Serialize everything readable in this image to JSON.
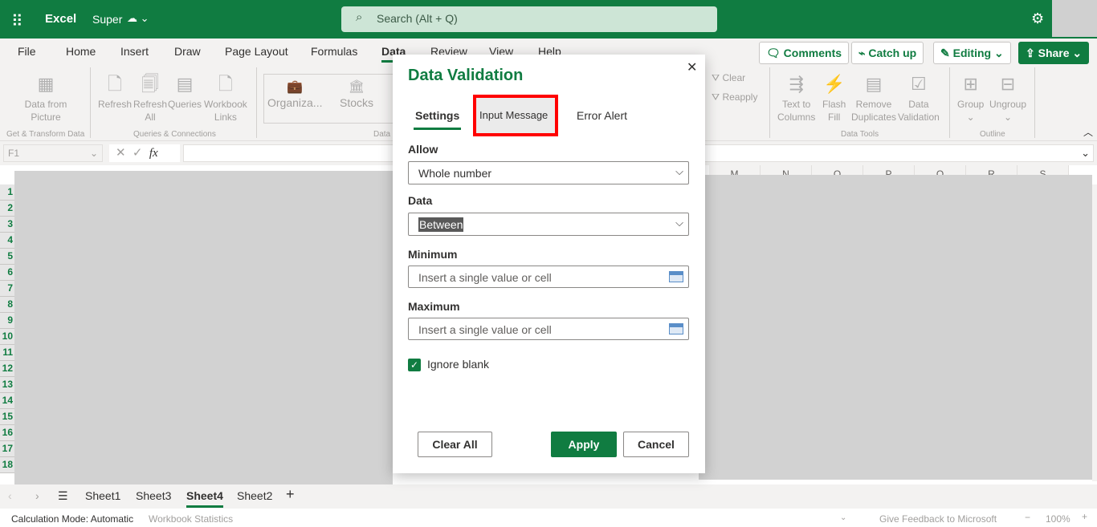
{
  "app": {
    "name": "Excel",
    "document": "Super",
    "search_placeholder": "Search (Alt + Q)"
  },
  "menu_tabs": [
    "File",
    "Home",
    "Insert",
    "Draw",
    "Page Layout",
    "Formulas",
    "Data",
    "Review",
    "View",
    "Help"
  ],
  "active_tab": "Data",
  "top_buttons": {
    "comments": "Comments",
    "catch_up": "Catch up",
    "editing": "Editing",
    "share": "Share"
  },
  "ribbon": {
    "data_from_picture": [
      "Data from",
      "Picture"
    ],
    "refresh": "Refresh",
    "refresh_all": [
      "Refresh",
      "All"
    ],
    "queries": "Queries",
    "workbook_links": [
      "Workbook",
      "Links"
    ],
    "organization": "Organiza...",
    "stocks": "Stocks",
    "clear": "Clear",
    "reapply": "Reapply",
    "text_to_columns": [
      "Text to",
      "Columns"
    ],
    "flash_fill": [
      "Flash",
      "Fill"
    ],
    "remove_duplicates": [
      "Remove",
      "Duplicates"
    ],
    "data_validation": [
      "Data",
      "Validation"
    ],
    "group": "Group",
    "ungroup": "Ungroup",
    "groups": {
      "get_transform": "Get & Transform Data",
      "queries_connections": "Queries & Connections",
      "data_types": "Data",
      "data_tools": "Data Tools",
      "outline": "Outline"
    }
  },
  "formula_bar": {
    "name_box": "F1",
    "fx": "fx",
    "value": ""
  },
  "columns": [
    "M",
    "N",
    "O",
    "P",
    "Q",
    "R",
    "S"
  ],
  "rows": [
    "1",
    "2",
    "3",
    "4",
    "5",
    "6",
    "7",
    "8",
    "9",
    "10",
    "11",
    "12",
    "13",
    "14",
    "15",
    "16",
    "17",
    "18"
  ],
  "dialog": {
    "title": "Data Validation",
    "tabs": [
      "Settings",
      "Input Message",
      "Error Alert"
    ],
    "active_tab": "Settings",
    "allow_label": "Allow",
    "allow_value": "Whole number",
    "data_label": "Data",
    "data_value": "Between",
    "minimum_label": "Minimum",
    "minimum_placeholder": "Insert a single value or cell",
    "maximum_label": "Maximum",
    "maximum_placeholder": "Insert a single value or cell",
    "ignore_blank": "Ignore blank",
    "ignore_blank_checked": true,
    "clear_all": "Clear All",
    "apply": "Apply",
    "cancel": "Cancel"
  },
  "sheets": [
    "Sheet1",
    "Sheet3",
    "Sheet4",
    "Sheet2"
  ],
  "active_sheet": "Sheet4",
  "status": {
    "calc_mode": "Calculation Mode: Automatic",
    "workbook_stats": "Workbook Statistics",
    "feedback": "Give Feedback to Microsoft",
    "zoom": "100%"
  },
  "colors": {
    "brand": "#107c41",
    "highlight": "#ff0000"
  }
}
